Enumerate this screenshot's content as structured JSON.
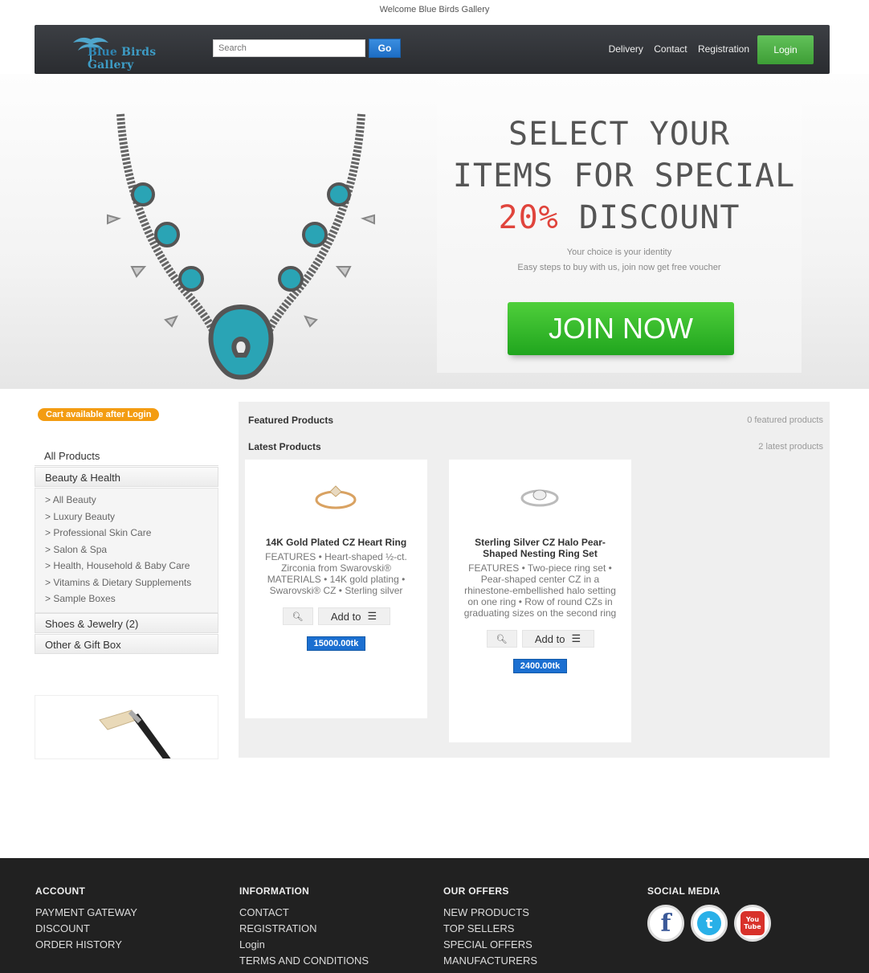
{
  "welcome": "Welcome Blue Birds Gallery",
  "header": {
    "logo_text_1": "Blue",
    "logo_text_2": "Birds Gallery",
    "search_placeholder": "Search",
    "go_label": "Go",
    "nav": [
      "Delivery",
      "Contact",
      "Registration"
    ],
    "login_label": "Login"
  },
  "hero": {
    "line1": "SELECT YOUR",
    "line2": "ITEMS FOR SPECIAL",
    "line3_pct": "20%",
    "line3_rest": " DISCOUNT",
    "sub1": "Your choice is your identity",
    "sub2": "Easy steps to buy with us, join now get free voucher",
    "join_label": "JOIN NOW"
  },
  "sidebar": {
    "cart_badge": "Cart available after Login",
    "all_products": "All Products",
    "beauty": "Beauty & Health",
    "beauty_items": [
      "All Beauty",
      "Luxury Beauty",
      "Professional Skin Care",
      "Salon & Spa",
      "Health, Household & Baby Care",
      "Vitamins & Dietary Supplements",
      "Sample Boxes"
    ],
    "shoes": "Shoes & Jewelry (2)",
    "other": "Other & Gift Box"
  },
  "main": {
    "featured_title": "Featured Products",
    "featured_count": "0 featured products",
    "latest_title": "Latest Products",
    "latest_count": "2 latest products",
    "products": [
      {
        "name": "14K Gold Plated CZ Heart Ring",
        "desc": "FEATURES • Heart-shaped ½-ct. Zirconia from Swarovski® MATERIALS • 14K gold plating • Swarovski® CZ • Sterling silver",
        "add_label": "Add to",
        "price": "15000.00tk"
      },
      {
        "name": "Sterling Silver CZ Halo Pear-Shaped Nesting Ring Set",
        "desc": "FEATURES • Two-piece ring set • Pear-shaped center CZ in a rhinestone-embellished halo setting on one ring • Row of round CZs in graduating sizes on the second ring",
        "add_label": "Add to",
        "price": "2400.00tk"
      }
    ]
  },
  "footer": {
    "account": {
      "title": "ACCOUNT",
      "items": [
        "PAYMENT GATEWAY",
        "DISCOUNT",
        "ORDER HISTORY"
      ]
    },
    "information": {
      "title": "INFORMATION",
      "items": [
        "CONTACT",
        "REGISTRATION",
        "Login",
        "TERMS AND CONDITIONS"
      ]
    },
    "offers": {
      "title": "OUR OFFERS",
      "items": [
        "NEW PRODUCTS",
        "TOP SELLERS",
        "SPECIAL OFFERS",
        "MANUFACTURERS"
      ]
    },
    "social": {
      "title": "SOCIAL MEDIA",
      "facebook": "f",
      "twitter": "t",
      "youtube_1": "You",
      "youtube_2": "Tube"
    }
  },
  "colors": {
    "accent_green": "#3d9e36",
    "accent_blue": "#1b6fd1",
    "badge_orange": "#f39c12",
    "discount_red": "#e0443c"
  },
  "icons": [
    "logo-bird-icon",
    "zoom-icon",
    "cart-icon",
    "facebook-icon",
    "twitter-icon",
    "youtube-icon"
  ]
}
